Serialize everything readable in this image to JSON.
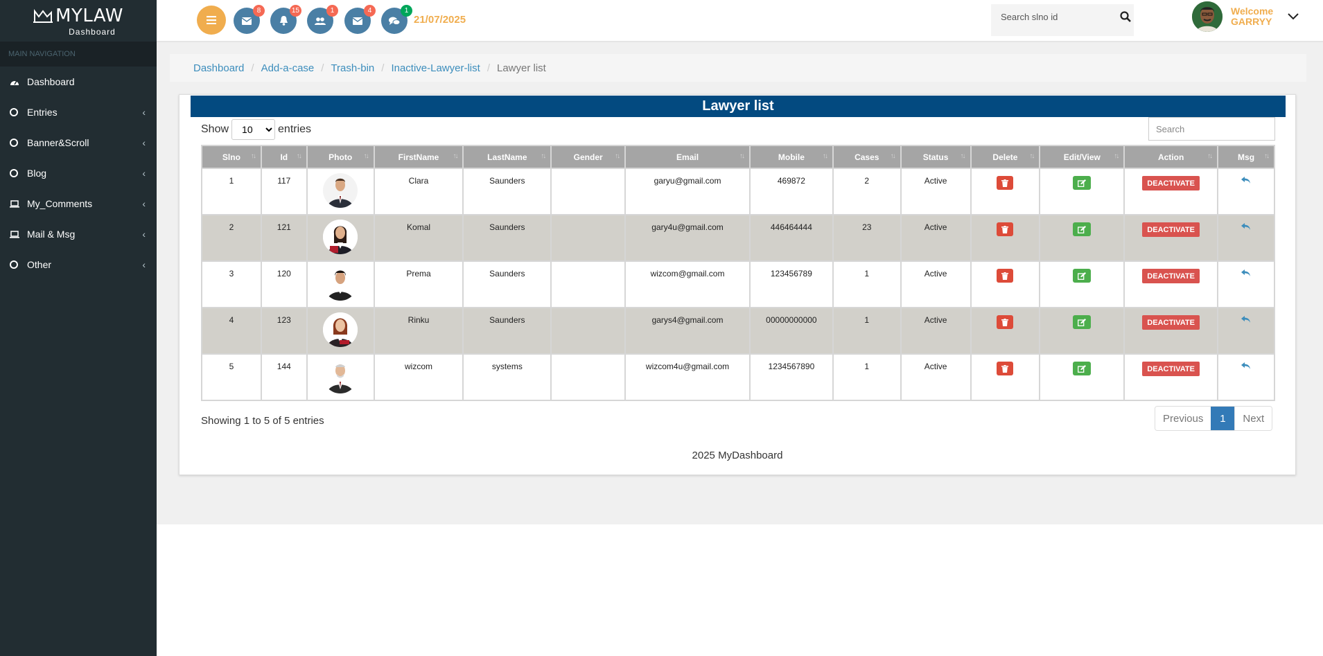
{
  "sidebar": {
    "logo_text": "MYLAW",
    "logo_sub": "Dashboard",
    "nav_header": "MAIN NAVIGATION",
    "items": [
      {
        "label": "Dashboard",
        "icon": "dashboard-icon"
      },
      {
        "label": "Entries",
        "icon": "circle-icon"
      },
      {
        "label": "Banner&Scroll",
        "icon": "circle-icon"
      },
      {
        "label": "Blog",
        "icon": "circle-icon"
      },
      {
        "label": "My_Comments",
        "icon": "laptop-icon"
      },
      {
        "label": "Mail & Msg",
        "icon": "laptop-icon"
      },
      {
        "label": "Other",
        "icon": "circle-icon"
      }
    ]
  },
  "header": {
    "badges": [
      "8",
      "15",
      "1",
      "4",
      "1"
    ],
    "date": "21/07/2025",
    "search_placeholder": "Search slno id",
    "welcome": "Welcome",
    "user": "GARRYY"
  },
  "breadcrumb": [
    "Dashboard",
    "Add-a-case",
    "Trash-bin",
    "Inactive-Lawyer-list",
    "Lawyer list"
  ],
  "panel": {
    "title": "Lawyer list",
    "show": "Show",
    "entries": "entries",
    "page_size": "10",
    "search_placeholder": "Search",
    "info": "Showing 1 to 5 of 5 entries",
    "prev": "Previous",
    "page": "1",
    "next": "Next",
    "footer": "2025 MyDashboard"
  },
  "table": {
    "headers": [
      "Slno",
      "Id",
      "Photo",
      "FirstName",
      "LastName",
      "Gender",
      "Email",
      "Mobile",
      "Cases",
      "Status",
      "Delete",
      "Edit/View",
      "Action",
      "Msg"
    ],
    "action_label": "DEACTIVATE",
    "rows": [
      {
        "slno": "1",
        "id": "117",
        "first": "Clara",
        "last": "Saunders",
        "gender": "",
        "email": "garyu@gmail.com",
        "mobile": "469872",
        "cases": "2",
        "status": "Active"
      },
      {
        "slno": "2",
        "id": "121",
        "first": "Komal",
        "last": "Saunders",
        "gender": "",
        "email": "gary4u@gmail.com",
        "mobile": "446464444",
        "cases": "23",
        "status": "Active"
      },
      {
        "slno": "3",
        "id": "120",
        "first": "Prema",
        "last": "Saunders",
        "gender": "",
        "email": "wizcom@gmail.com",
        "mobile": "123456789",
        "cases": "1",
        "status": "Active"
      },
      {
        "slno": "4",
        "id": "123",
        "first": "Rinku",
        "last": "Saunders",
        "gender": "",
        "email": "garys4@gmail.com",
        "mobile": "00000000000",
        "cases": "1",
        "status": "Active"
      },
      {
        "slno": "5",
        "id": "144",
        "first": "wizcom",
        "last": "systems",
        "gender": "",
        "email": "wizcom4u@gmail.com",
        "mobile": "1234567890",
        "cases": "1",
        "status": "Active"
      }
    ]
  }
}
